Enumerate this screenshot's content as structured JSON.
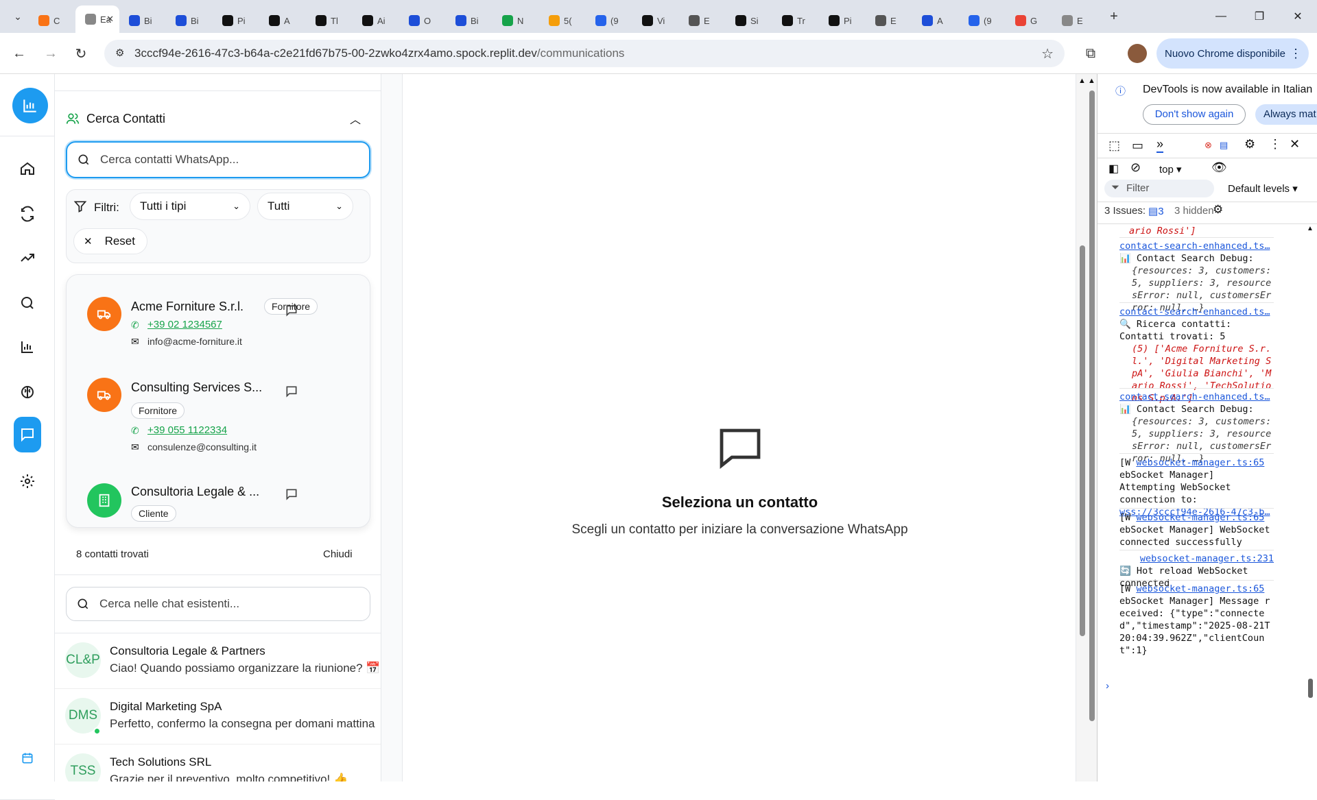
{
  "browser": {
    "tabs": [
      {
        "label": "C",
        "color": "#f97316"
      },
      {
        "label": "Ea",
        "color": "#888888",
        "active": true
      },
      {
        "label": "Bi",
        "color": "#1d4ed8"
      },
      {
        "label": "Bi",
        "color": "#1d4ed8"
      },
      {
        "label": "Pi",
        "color": "#111111"
      },
      {
        "label": "A",
        "color": "#111111"
      },
      {
        "label": "Tl",
        "color": "#111111"
      },
      {
        "label": "Ai",
        "color": "#111111"
      },
      {
        "label": "O",
        "color": "#1d4ed8"
      },
      {
        "label": "Bi",
        "color": "#1d4ed8"
      },
      {
        "label": "N",
        "color": "#16a34a"
      },
      {
        "label": "5(",
        "color": "#f59e0b"
      },
      {
        "label": "(9",
        "color": "#2563eb"
      },
      {
        "label": "Vi",
        "color": "#111111"
      },
      {
        "label": "E",
        "color": "#555555"
      },
      {
        "label": "Si",
        "color": "#111111"
      },
      {
        "label": "Tr",
        "color": "#111111"
      },
      {
        "label": "Pi",
        "color": "#111111"
      },
      {
        "label": "E",
        "color": "#555555"
      },
      {
        "label": "A",
        "color": "#1d4ed8"
      },
      {
        "label": "(9",
        "color": "#2563eb"
      },
      {
        "label": "G",
        "color": "#ea4335"
      },
      {
        "label": "E",
        "color": "#888888"
      }
    ],
    "url_host": "3cccf94e-2616-47c3-b64a-c2e21fd67b75-00-2zwko4zrx4amo.spock.replit.dev",
    "url_path": "/communications",
    "update_button": "Nuovo Chrome disponibile"
  },
  "contacts_panel": {
    "title": "Cerca Contatti",
    "search_placeholder": "Cerca contatti WhatsApp...",
    "filters_label": "Filtri:",
    "type_select": "Tutti i tipi",
    "status_select": "Tutti",
    "reset_label": "Reset",
    "contacts": [
      {
        "name": "Acme Forniture S.r.l.",
        "badge": "Fornitore",
        "phone": "+39 02 1234567",
        "email": "info@acme-forniture.it",
        "color": "#f97316"
      },
      {
        "name": "Consulting Services S...",
        "badge": "Fornitore",
        "phone": "+39 055 1122334",
        "email": "consulenze@consulting.it",
        "color": "#f97316"
      },
      {
        "name": "Consultoria Legale & ...",
        "badge": "Cliente",
        "phone": "",
        "email": "",
        "color": "#22c55e"
      }
    ],
    "found_count": "8 contatti trovati",
    "close_label": "Chiudi"
  },
  "chat_list": {
    "search_placeholder": "Cerca nelle chat esistenti...",
    "chats": [
      {
        "initials": "CL&P",
        "name": "Consultoria Legale & Partners",
        "message": "Ciao! Quando possiamo organizzare la riunione? 📅"
      },
      {
        "initials": "DMS",
        "name": "Digital Marketing SpA",
        "message": "Perfetto, confermo la consegna per domani mattina"
      },
      {
        "initials": "TSS",
        "name": "Tech Solutions SRL",
        "message": "Grazie per il preventivo, molto competitivo! 👍"
      }
    ]
  },
  "empty_state": {
    "title": "Seleziona un contatto",
    "subtitle": "Scegli un contatto per iniziare la conversazione WhatsApp"
  },
  "devtools": {
    "banner": "DevTools is now available in Italian",
    "dont_show": "Don't show again",
    "always_match": "Always mat",
    "context": "top",
    "filter_placeholder": "Filter",
    "levels": "Default levels",
    "issues_label": "3 Issues:",
    "issues_count": "3",
    "hidden": "3 hidden",
    "logs": {
      "l0": "ario Rossi']",
      "l1_link": "contact-search-enhanced.ts…",
      "l1_text": "📊 Contact Search Debug:",
      "l1_obj": "{resources: 3, customers: 5, suppliers: 3, resourcesError: null, customersError: null, …}",
      "l2_link": "contact-search-enhanced.ts…",
      "l2_text": "🔍 Ricerca contatti:",
      "l2_found": "Contatti trovati: 5",
      "l2_list": "(5) ['Acme Forniture S.r.l.', 'Digital Marketing SpA', 'Giulia Bianchi', 'Mario Rossi', 'TechSolutions S.p.A.']",
      "l3_link": "contact-search-enhanced.ts…",
      "l3_text": "📊 Contact Search Debug:",
      "l3_obj": "{resources: 3, customers: 5, suppliers: 3, resourcesError: null, customersError: null, …}",
      "l4_prefix": "[W",
      "l4_link": "websocket-manager.ts:65",
      "l4_text": "ebSocket Manager] Attempting WebSocket connection to:",
      "l4_url": "wss://3cccf94e-2616-47c3-b…",
      "l5_prefix": "[W",
      "l5_link": "websocket-manager.ts:65",
      "l5_text": "ebSocket Manager] WebSocket connected successfully",
      "l6_link": "websocket-manager.ts:231",
      "l6_text": "🔄 Hot reload WebSocket connected",
      "l7_prefix": "[W",
      "l7_link": "websocket-manager.ts:65",
      "l7_text": "ebSocket Manager] Message received: {\"type\":\"connected\",\"timestamp\":\"2025-08-21T20:04:39.962Z\",\"clientCount\":1}"
    }
  }
}
